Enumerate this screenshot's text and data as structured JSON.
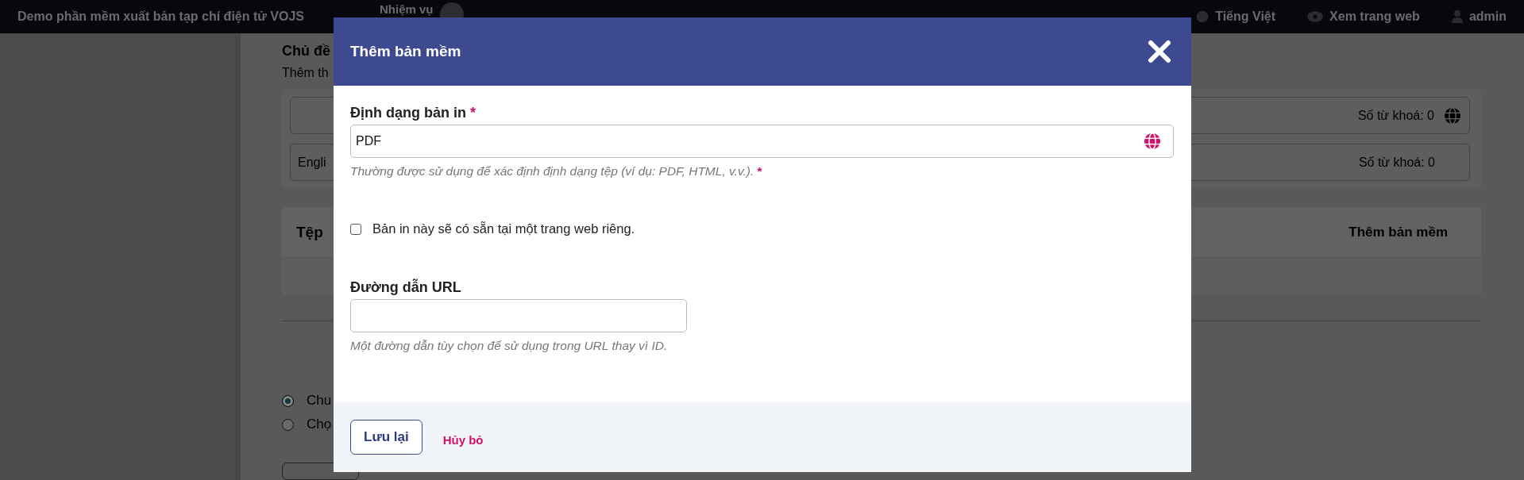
{
  "topbar": {
    "site_title": "Demo phần mềm xuất bản tạp chí điện tử VOJS",
    "tasks_label": "Nhiệm vụ",
    "language": "Tiếng Việt",
    "view_site": "Xem trang web",
    "user": "admin"
  },
  "background": {
    "section_title": "Chủ đề",
    "section_hint": "Thêm th",
    "keyword_rows": [
      {
        "prefix": "",
        "count": "Số từ khoá: 0",
        "globe": true
      },
      {
        "prefix": "Engli",
        "count": "Số từ khoá: 0",
        "globe": false
      }
    ],
    "files_section": {
      "title": "Tệp",
      "action": "Thêm bản mềm"
    },
    "radios": [
      {
        "label": "Chu",
        "selected": true
      },
      {
        "label": "Chọ",
        "selected": false
      }
    ]
  },
  "modal": {
    "title": "Thêm bản mềm",
    "format_field": {
      "label": "Định dạng bản in",
      "required_mark": "*",
      "value": "PDF",
      "help": "Thường được sử dụng để xác định định dạng tệp (ví dụ: PDF, HTML, v.v.).",
      "help_mark": "*"
    },
    "own_page_checkbox": {
      "label": "Bản in này sẽ có sẵn tại một trang web riêng.",
      "checked": false
    },
    "url_field": {
      "label": "Đường dẫn URL",
      "help": "Một đường dẫn tùy chọn để sử dụng trong URL thay vì ID."
    },
    "buttons": [
      {
        "label": "Lưu lại",
        "kind": "primary"
      },
      {
        "label": "Hủy bỏ",
        "kind": "link"
      }
    ]
  }
}
